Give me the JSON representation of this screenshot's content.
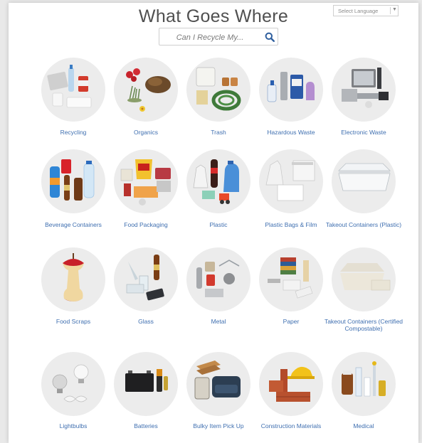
{
  "header": {
    "title": "What Goes Where",
    "language_select": "Select Language",
    "language_arrow": "▼"
  },
  "search": {
    "placeholder": "Can I Recycle My..."
  },
  "colors": {
    "link": "#3f6fb0",
    "circle": "#ececec",
    "title": "#505050"
  },
  "categories": [
    {
      "label": "Recycling",
      "icon": "recycling-icon"
    },
    {
      "label": "Organics",
      "icon": "organics-icon"
    },
    {
      "label": "Trash",
      "icon": "trash-icon"
    },
    {
      "label": "Hazardous Waste",
      "icon": "hazardous-waste-icon"
    },
    {
      "label": "Electronic Waste",
      "icon": "electronic-waste-icon"
    },
    {
      "label": "Beverage Containers",
      "icon": "beverage-containers-icon"
    },
    {
      "label": "Food Packaging",
      "icon": "food-packaging-icon"
    },
    {
      "label": "Plastic",
      "icon": "plastic-icon"
    },
    {
      "label": "Plastic Bags & Film",
      "icon": "plastic-bags-icon"
    },
    {
      "label": "Takeout Containers (Plastic)",
      "icon": "takeout-plastic-icon"
    },
    {
      "label": "Food Scraps",
      "icon": "food-scraps-icon"
    },
    {
      "label": "Glass",
      "icon": "glass-icon"
    },
    {
      "label": "Metal",
      "icon": "metal-icon"
    },
    {
      "label": "Paper",
      "icon": "paper-icon"
    },
    {
      "label": "Takeout Containers (Certified Compostable)",
      "icon": "takeout-compostable-icon"
    },
    {
      "label": "Lightbulbs",
      "icon": "lightbulbs-icon"
    },
    {
      "label": "Batteries",
      "icon": "batteries-icon"
    },
    {
      "label": "Bulky Item Pick Up",
      "icon": "bulky-item-icon"
    },
    {
      "label": "Construction Materials",
      "icon": "construction-materials-icon"
    },
    {
      "label": "Medical",
      "icon": "medical-icon"
    }
  ]
}
